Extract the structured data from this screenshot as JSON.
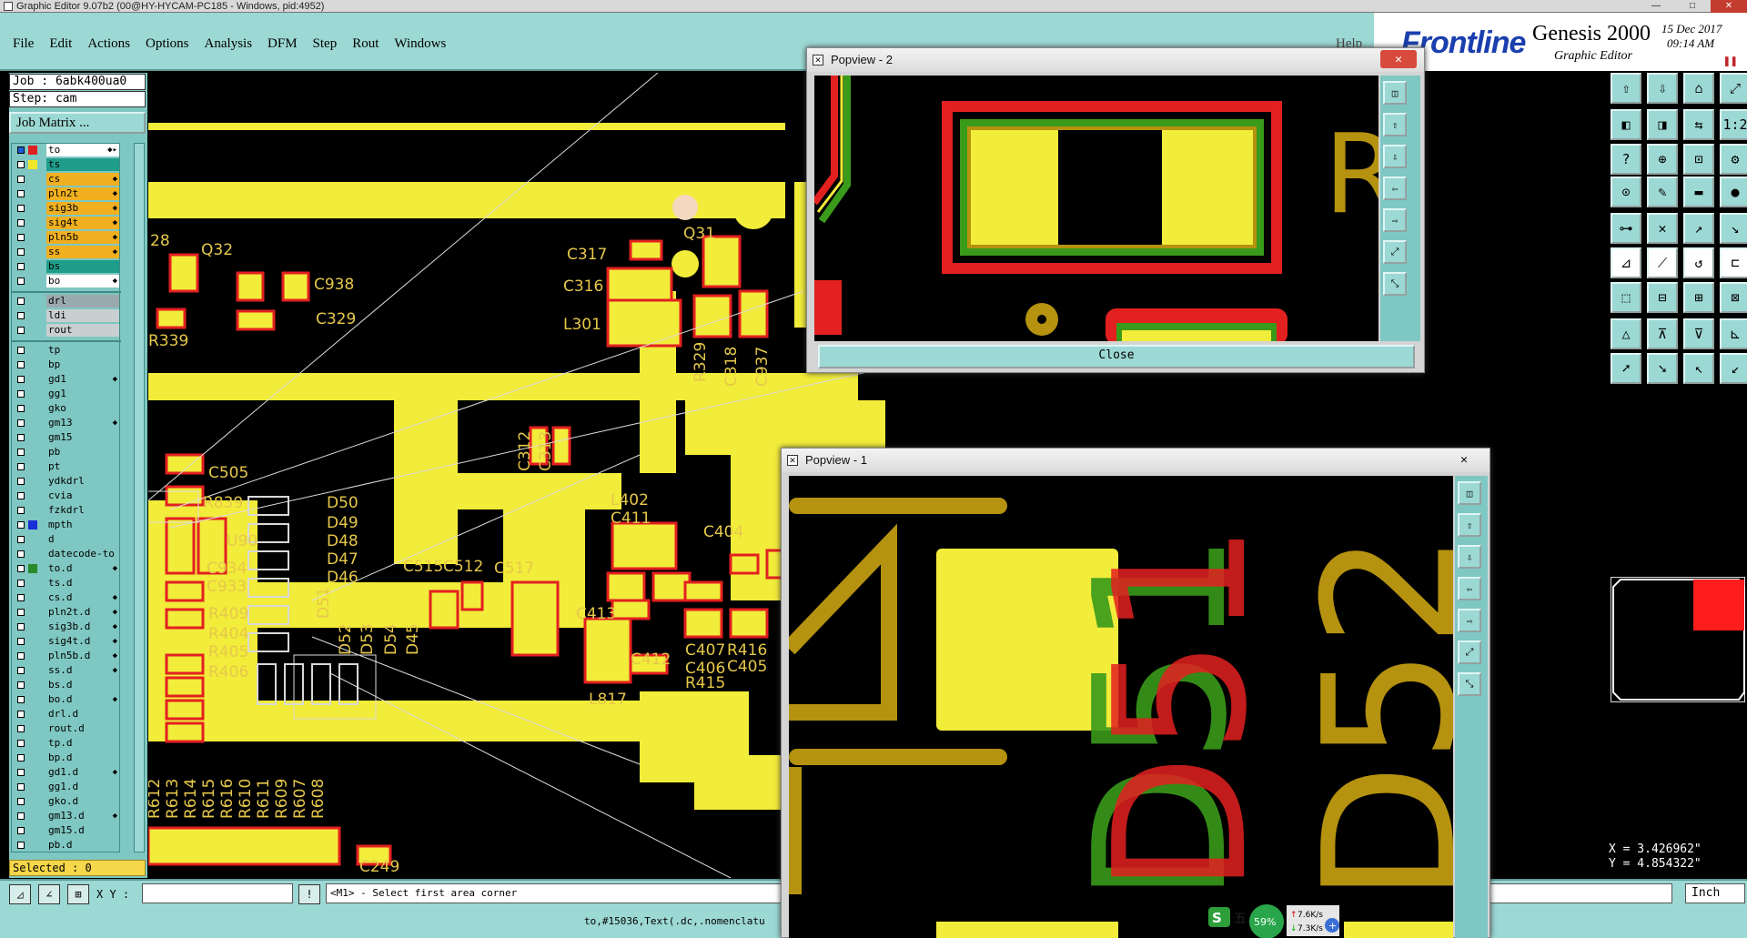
{
  "window": {
    "title": "Graphic Editor 9.07b2 (00@HY-HYCAM-PC185 - Windows, pid:4952)",
    "minimize": "—",
    "maximize": "□",
    "close": "✕"
  },
  "menu": {
    "items": [
      "File",
      "Edit",
      "Actions",
      "Options",
      "Analysis",
      "DFM",
      "Step",
      "Rout",
      "Windows"
    ],
    "help": "Help"
  },
  "brand": {
    "logo": "Frontline",
    "product": "Genesis 2000",
    "subtitle": "Graphic Editor",
    "date": "15 Dec 2017",
    "time": "09:14 AM"
  },
  "job": {
    "job_label": "Job : 6abk400ua0",
    "step_label": "Step: cam",
    "matrix_button": "Job Matrix ..."
  },
  "layers": {
    "board": [
      {
        "name": "to",
        "color": "#ffffff",
        "swatch": "#e02020",
        "checked": true,
        "arrow": "◆▸"
      },
      {
        "name": "ts",
        "color": "#1e9e8a",
        "swatch": "#f2e82a",
        "checked": false,
        "arrow": ""
      },
      {
        "name": "cs",
        "color": "#f0b020",
        "swatch": "",
        "checked": false,
        "arrow": "◆"
      },
      {
        "name": "pln2t",
        "color": "#f0b020",
        "swatch": "",
        "checked": false,
        "arrow": "◆"
      },
      {
        "name": "sig3b",
        "color": "#f0b020",
        "swatch": "",
        "checked": false,
        "arrow": "◆"
      },
      {
        "name": "sig4t",
        "color": "#f0b020",
        "swatch": "",
        "checked": false,
        "arrow": "◆"
      },
      {
        "name": "pln5b",
        "color": "#f0b020",
        "swatch": "",
        "checked": false,
        "arrow": "◆"
      },
      {
        "name": "ss",
        "color": "#f0b020",
        "swatch": "",
        "checked": false,
        "arrow": "◆"
      },
      {
        "name": "bs",
        "color": "#1e9e8a",
        "swatch": "",
        "checked": false,
        "arrow": ""
      },
      {
        "name": "bo",
        "color": "#ffffff",
        "swatch": "",
        "checked": false,
        "arrow": "◆"
      }
    ],
    "drill": [
      {
        "name": "drl",
        "color": "#9aa9ad",
        "checked": false,
        "arrow": ""
      },
      {
        "name": "ldi",
        "color": "#c9cfd0",
        "checked": false,
        "arrow": ""
      },
      {
        "name": "rout",
        "color": "#c9cfd0",
        "checked": false,
        "arrow": ""
      }
    ],
    "misc": [
      {
        "name": "tp",
        "color": "#7fc7c2",
        "checked": false,
        "arrow": ""
      },
      {
        "name": "bp",
        "color": "#7fc7c2",
        "checked": false,
        "arrow": ""
      },
      {
        "name": "gd1",
        "color": "#7fc7c2",
        "checked": false,
        "arrow": "◆"
      },
      {
        "name": "gg1",
        "color": "#7fc7c2",
        "checked": false,
        "arrow": ""
      },
      {
        "name": "gko",
        "color": "#7fc7c2",
        "checked": false,
        "arrow": ""
      },
      {
        "name": "gm13",
        "color": "#7fc7c2",
        "checked": false,
        "arrow": "◆"
      },
      {
        "name": "gm15",
        "color": "#7fc7c2",
        "checked": false,
        "arrow": ""
      },
      {
        "name": "pb",
        "color": "#7fc7c2",
        "checked": false,
        "arrow": ""
      },
      {
        "name": "pt",
        "color": "#7fc7c2",
        "checked": false,
        "arrow": ""
      },
      {
        "name": "ydkdrl",
        "color": "#7fc7c2",
        "checked": false,
        "arrow": ""
      },
      {
        "name": "cvia",
        "color": "#7fc7c2",
        "checked": false,
        "arrow": ""
      },
      {
        "name": "fzkdrl",
        "color": "#7fc7c2",
        "checked": false,
        "arrow": ""
      },
      {
        "name": "mpth",
        "color": "#7fc7c2",
        "checked": false,
        "swatch": "#1a2fd6",
        "arrow": ""
      },
      {
        "name": "d",
        "color": "#7fc7c2",
        "checked": false,
        "arrow": ""
      },
      {
        "name": "datecode-to",
        "color": "#7fc7c2",
        "checked": false,
        "arrow": ""
      },
      {
        "name": "to.d",
        "color": "#7fc7c2",
        "checked": false,
        "swatch": "#2a8a2a",
        "arrow": "◆"
      },
      {
        "name": "ts.d",
        "color": "#7fc7c2",
        "checked": false,
        "arrow": ""
      },
      {
        "name": "cs.d",
        "color": "#7fc7c2",
        "checked": false,
        "arrow": "◆"
      },
      {
        "name": "pln2t.d",
        "color": "#7fc7c2",
        "checked": false,
        "arrow": "◆"
      },
      {
        "name": "sig3b.d",
        "color": "#7fc7c2",
        "checked": false,
        "arrow": "◆"
      },
      {
        "name": "sig4t.d",
        "color": "#7fc7c2",
        "checked": false,
        "arrow": "◆"
      },
      {
        "name": "pln5b.d",
        "color": "#7fc7c2",
        "checked": false,
        "arrow": "◆"
      },
      {
        "name": "ss.d",
        "color": "#7fc7c2",
        "checked": false,
        "arrow": "◆"
      },
      {
        "name": "bs.d",
        "color": "#7fc7c2",
        "checked": false,
        "arrow": ""
      },
      {
        "name": "bo.d",
        "color": "#7fc7c2",
        "checked": false,
        "arrow": "◆"
      },
      {
        "name": "drl.d",
        "color": "#7fc7c2",
        "checked": false,
        "arrow": ""
      },
      {
        "name": "rout.d",
        "color": "#7fc7c2",
        "checked": false,
        "arrow": ""
      },
      {
        "name": "tp.d",
        "color": "#7fc7c2",
        "checked": false,
        "arrow": ""
      },
      {
        "name": "bp.d",
        "color": "#7fc7c2",
        "checked": false,
        "arrow": ""
      },
      {
        "name": "gd1.d",
        "color": "#7fc7c2",
        "checked": false,
        "arrow": "◆"
      },
      {
        "name": "gg1.d",
        "color": "#7fc7c2",
        "checked": false,
        "arrow": ""
      },
      {
        "name": "gko.d",
        "color": "#7fc7c2",
        "checked": false,
        "arrow": ""
      },
      {
        "name": "gm13.d",
        "color": "#7fc7c2",
        "checked": false,
        "arrow": "◆"
      },
      {
        "name": "gm15.d",
        "color": "#7fc7c2",
        "checked": false,
        "arrow": ""
      },
      {
        "name": "pb.d",
        "color": "#7fc7c2",
        "checked": false,
        "arrow": ""
      }
    ],
    "selected_label": "Selected : 0"
  },
  "canvas": {
    "labels": [
      {
        "text": "28"
      },
      {
        "text": "Q32"
      },
      {
        "text": "C938"
      },
      {
        "text": "C329"
      },
      {
        "text": "R339"
      },
      {
        "text": "C317"
      },
      {
        "text": "C316"
      },
      {
        "text": "L301"
      },
      {
        "text": "Q31"
      },
      {
        "text": "R329"
      },
      {
        "text": "C318"
      },
      {
        "text": "C937"
      },
      {
        "text": "C312"
      },
      {
        "text": "C313"
      },
      {
        "text": "C505"
      },
      {
        "text": "R839"
      },
      {
        "text": "U90"
      },
      {
        "text": "C934"
      },
      {
        "text": "C933"
      },
      {
        "text": "D50"
      },
      {
        "text": "D49"
      },
      {
        "text": "D48"
      },
      {
        "text": "D47"
      },
      {
        "text": "D46"
      },
      {
        "text": "R409"
      },
      {
        "text": "R404"
      },
      {
        "text": "R405"
      },
      {
        "text": "R406"
      },
      {
        "text": "C515"
      },
      {
        "text": "C512"
      },
      {
        "text": "C517"
      },
      {
        "text": "L402"
      },
      {
        "text": "C411"
      },
      {
        "text": "C404"
      },
      {
        "text": "C413"
      },
      {
        "text": "C412"
      },
      {
        "text": "C407"
      },
      {
        "text": "C406"
      },
      {
        "text": "R416"
      },
      {
        "text": "C405"
      },
      {
        "text": "R415"
      },
      {
        "text": "L817"
      },
      {
        "text": "C249"
      },
      {
        "text": "D51"
      },
      {
        "text": "D52"
      },
      {
        "text": "D53"
      },
      {
        "text": "D54"
      },
      {
        "text": "D45"
      },
      {
        "text": "R612"
      },
      {
        "text": "R613"
      },
      {
        "text": "R614"
      },
      {
        "text": "R615"
      },
      {
        "text": "R616"
      },
      {
        "text": "R610"
      },
      {
        "text": "R611"
      },
      {
        "text": "R609"
      },
      {
        "text": "R607"
      },
      {
        "text": "R608"
      }
    ],
    "colors": {
      "copper": "#f2ec3a",
      "pad_outline": "#e32020",
      "silk": "#b5920f",
      "green": "#3a9a1a"
    }
  },
  "popview2": {
    "title": "Popview - 2",
    "close_label": "Close",
    "silk_text": "R"
  },
  "popview1": {
    "title": "Popview - 1",
    "silk_text_a": "D51",
    "silk_text_b": "D52"
  },
  "coords": {
    "x": "X = 3.426962\"",
    "y": "Y = 4.854322\""
  },
  "statusbar": {
    "xy_label": "X Y :",
    "xy_value": "",
    "prompt": "<M1> - Select first area corner",
    "unit": "Inch",
    "bottom_text": "to,#15036,Text(.dc,.nomenclatu"
  },
  "tray": {
    "percent": "59%",
    "up_rate": "7.6K/s",
    "down_rate": "7.3K/s",
    "ime": "五"
  }
}
